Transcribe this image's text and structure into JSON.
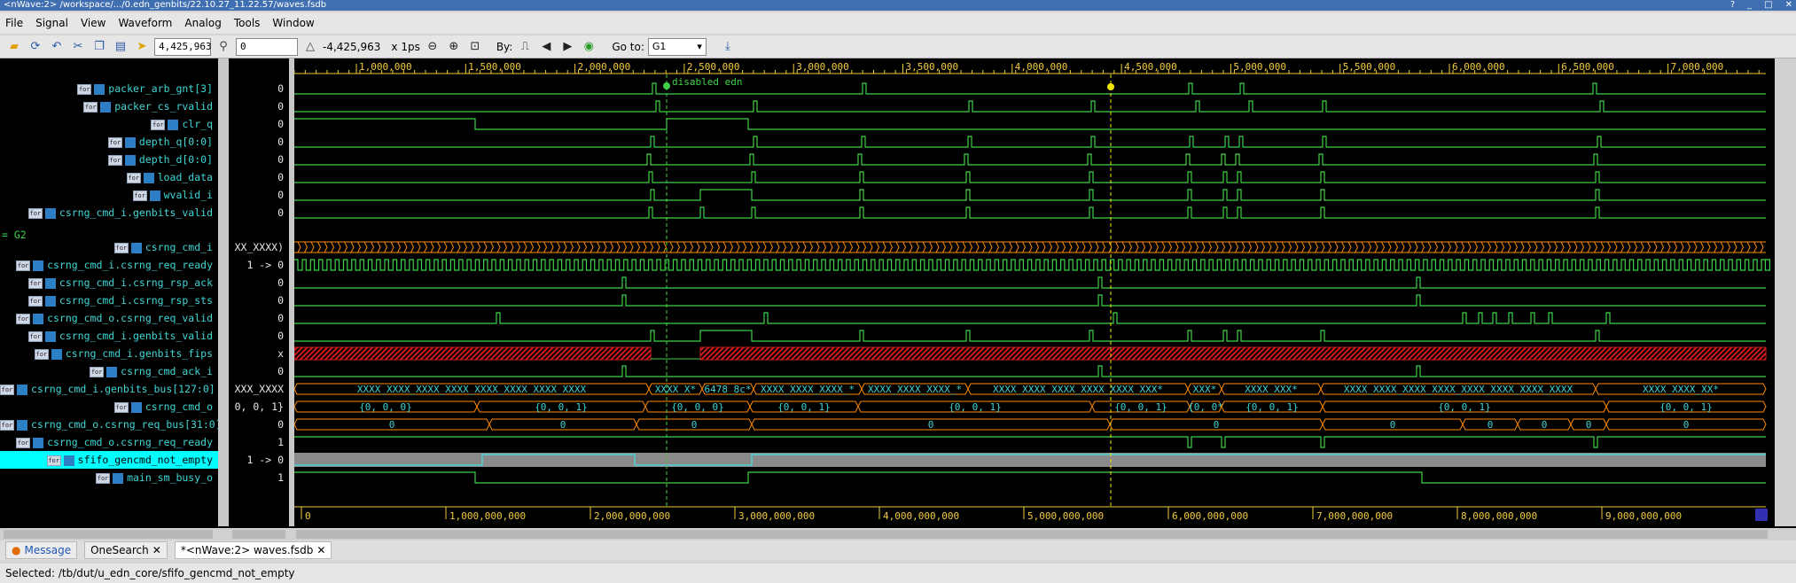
{
  "window": {
    "title": "<nWave:2> /workspace/.../0.edn_genbits/22.10.27_11.22.57/waves.fsdb"
  },
  "menu": [
    "File",
    "Signal",
    "View",
    "Waveform",
    "Analog",
    "Tools",
    "Window"
  ],
  "toolbar": {
    "cursor_time": "4,425,963",
    "marker_time": "0",
    "delta_time": "-4,425,963",
    "time_unit": "x 1ps",
    "by_label": "By:",
    "goto_label": "Go to:",
    "goto_value": "G1"
  },
  "signals": [
    {
      "name": "packer_arb_gnt[3]",
      "value": "0"
    },
    {
      "name": "packer_cs_rvalid",
      "value": "0"
    },
    {
      "name": "clr_q",
      "value": "0"
    },
    {
      "name": "depth_q[0:0]",
      "value": "0"
    },
    {
      "name": "depth_d[0:0]",
      "value": "0"
    },
    {
      "name": "load_data",
      "value": "0"
    },
    {
      "name": "wvalid_i",
      "value": "0"
    },
    {
      "name": "csrng_cmd_i.genbits_valid",
      "value": "0"
    },
    {
      "name": "csrng_cmd_i",
      "value": "XX_XXXX)"
    },
    {
      "name": "csrng_cmd_i.csrng_req_ready",
      "value": "1 -> 0"
    },
    {
      "name": "csrng_cmd_i.csrng_rsp_ack",
      "value": "0"
    },
    {
      "name": "csrng_cmd_i.csrng_rsp_sts",
      "value": "0"
    },
    {
      "name": "csrng_cmd_o.csrng_req_valid",
      "value": "0"
    },
    {
      "name": "csrng_cmd_i.genbits_valid",
      "value": "0"
    },
    {
      "name": "csrng_cmd_i.genbits_fips",
      "value": "x"
    },
    {
      "name": "csrng_cmd_ack_i",
      "value": "0"
    },
    {
      "name": "csrng_cmd_i.genbits_bus[127:0]",
      "value": "XXX_XXXX"
    },
    {
      "name": "csrng_cmd_o",
      "value": "0, 0, 1}"
    },
    {
      "name": "csrng_cmd_o.csrng_req_bus[31:0]",
      "value": "0"
    },
    {
      "name": "csrng_cmd_o.csrng_req_ready",
      "value": "1"
    },
    {
      "name": "sfifo_gencmd_not_empty",
      "value": "1 -> 0"
    },
    {
      "name": "main_sm_busy_o",
      "value": "1"
    }
  ],
  "group_label": "= G2",
  "marker_label": "disabled edn",
  "ruler_top": [
    "1,000,000",
    "1,500,000",
    "2,000,000",
    "2,500,000",
    "3,000,000",
    "3,500,000",
    "4,000,000",
    "4,500,000",
    "5,000,000",
    "5,500,000",
    "6,000,000",
    "6,500,000",
    "7,000,000"
  ],
  "ruler_bottom": [
    "0",
    "1,000,000,000",
    "2,000,000,000",
    "3,000,000,000",
    "4,000,000,000",
    "5,000,000,000",
    "6,000,000,000",
    "7,000,000,000",
    "8,000,000,000",
    "9,000,000,000"
  ],
  "bus_labels": {
    "genbits_bus": [
      "XXXX_XXXX_XXXX_XXXX_XXXX_XXXX_XXXX_XXXX",
      "XXXX_X*",
      "6478_8c*",
      "XXXX_XXXX_XXXX_*",
      "XXXX_XXXX_XXXX_*",
      "XXXX_XXXX_XXXX_XXXX_XXXX_XXX*",
      "XXX*",
      "XXXX_XXX*",
      "XXXX_XXXX_XXXX_XXXX_XXXX_XXXX_XXXX_XXXX",
      "XXXX_XXXX_XX*"
    ],
    "cmd_o": [
      "{0, 0, 0}",
      "{0, 0, 1}",
      "{0, 0, 0}",
      "{0, 0, 1}",
      "{0, 0, 1}",
      "{0, 0, 1}",
      "{0, 0*",
      "{0, 0, 1}",
      "{0, 0, 1}",
      "{0, 0, 1}"
    ],
    "req_bus": [
      "0",
      "0",
      "0",
      "0",
      "0",
      "0",
      "0",
      "0",
      "0",
      "0"
    ]
  },
  "tabs": [
    "Message",
    "OneSearch",
    "*<nWave:2> waves.fsdb"
  ],
  "status": "Selected: /tb/dut/u_edn_core/sfifo_gencmd_not_empty",
  "colors": {
    "wave_green": "#3fd34a",
    "wave_cyan": "#3fd4d4",
    "wave_orange": "#ff8a00",
    "wave_red": "#d11a1a",
    "cursor_yellow": "#f2e600",
    "selected_bg": "#00ffff"
  }
}
